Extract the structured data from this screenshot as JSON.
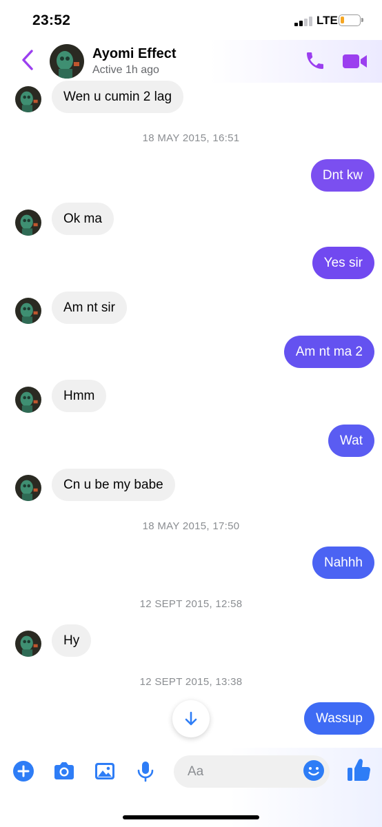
{
  "status_bar": {
    "time": "23:52",
    "network": "LTE"
  },
  "header": {
    "contact_name": "Ayomi Effect",
    "active_status": "Active 1h ago"
  },
  "timestamps": [
    "18 MAY 2015, 16:51",
    "18 MAY 2015, 17:50",
    "12 SEPT 2015, 12:58",
    "12 SEPT 2015, 13:38"
  ],
  "messages": [
    {
      "from": "them",
      "text": "Wen u cumin 2 lag"
    },
    {
      "from": "me",
      "text": "Dnt kw",
      "color": "#7B4FF0"
    },
    {
      "from": "them",
      "text": "Ok ma"
    },
    {
      "from": "me",
      "text": "Yes sir",
      "color": "#7149F0"
    },
    {
      "from": "them",
      "text": "Am nt sir"
    },
    {
      "from": "me",
      "text": "Am nt ma 2",
      "color": "#6452F0"
    },
    {
      "from": "them",
      "text": "Hmm"
    },
    {
      "from": "me",
      "text": "Wat",
      "color": "#5A5CF2"
    },
    {
      "from": "them",
      "text": "Cn u be my babe"
    },
    {
      "from": "me",
      "text": "Nahhh",
      "color": "#4B63F3"
    },
    {
      "from": "them",
      "text": "Hy"
    },
    {
      "from": "me",
      "text": "Wassup",
      "color": "#3E6BF4"
    }
  ],
  "composer": {
    "placeholder": "Aa"
  },
  "colors": {
    "accent_purple": "#9B3FEF",
    "accent_blue": "#2E7DF6",
    "incoming_bubble": "#F0F0F0",
    "timestamp_text": "#8A8D91"
  },
  "icons": {
    "back": "chevron-left-icon",
    "call": "phone-icon",
    "video": "video-camera-icon",
    "add": "plus-circle-icon",
    "camera": "camera-icon",
    "gallery": "image-icon",
    "mic": "microphone-icon",
    "emoji": "smiley-icon",
    "like": "thumbs-up-icon",
    "scroll": "arrow-down-icon"
  }
}
